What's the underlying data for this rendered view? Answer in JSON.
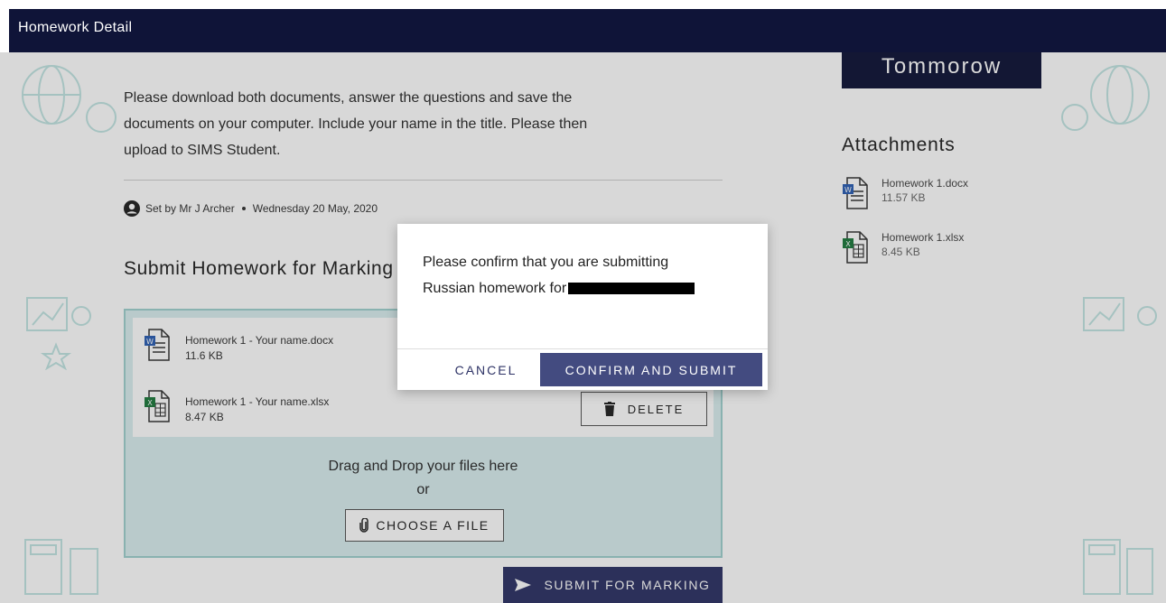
{
  "topbar": {
    "title": "Homework Detail"
  },
  "homework": {
    "description_lines": [
      "Please download both documents, answer the questions and save the",
      "documents on your computer. Include your name in the title. Please then",
      "upload to SIMS Student."
    ],
    "set_by": "Set by Mr J Archer",
    "set_date": "Wednesday 20 May, 2020"
  },
  "submit": {
    "title": "Submit Homework for Marking",
    "files": [
      {
        "name": "Homework 1 - Your name.docx",
        "size": "11.6 KB",
        "icon": "word-file-icon"
      },
      {
        "name": "Homework 1 - Your name.xlsx",
        "size": "8.47 KB",
        "icon": "excel-file-icon"
      }
    ],
    "delete_label": "DELETE",
    "drop_text": "Drag and Drop your files here",
    "or_text": "or",
    "choose_label": "CHOOSE A FILE",
    "submit_label": "SUBMIT FOR MARKING"
  },
  "sidebar": {
    "due_label": "Tommorow",
    "attachments_title": "Attachments",
    "attachments": [
      {
        "name": "Homework 1.docx",
        "size": "11.57 KB",
        "icon": "word-file-icon"
      },
      {
        "name": "Homework 1.xlsx",
        "size": "8.45 KB",
        "icon": "excel-file-icon"
      }
    ]
  },
  "modal": {
    "line1": "Please confirm that you are submitting",
    "line2": "Russian homework for",
    "cancel_label": "CANCEL",
    "confirm_label": "CONFIRM AND SUBMIT"
  },
  "colors": {
    "navy": "#0f1438",
    "button_primary": "#434b80",
    "dropzone": "#d9eef0"
  }
}
